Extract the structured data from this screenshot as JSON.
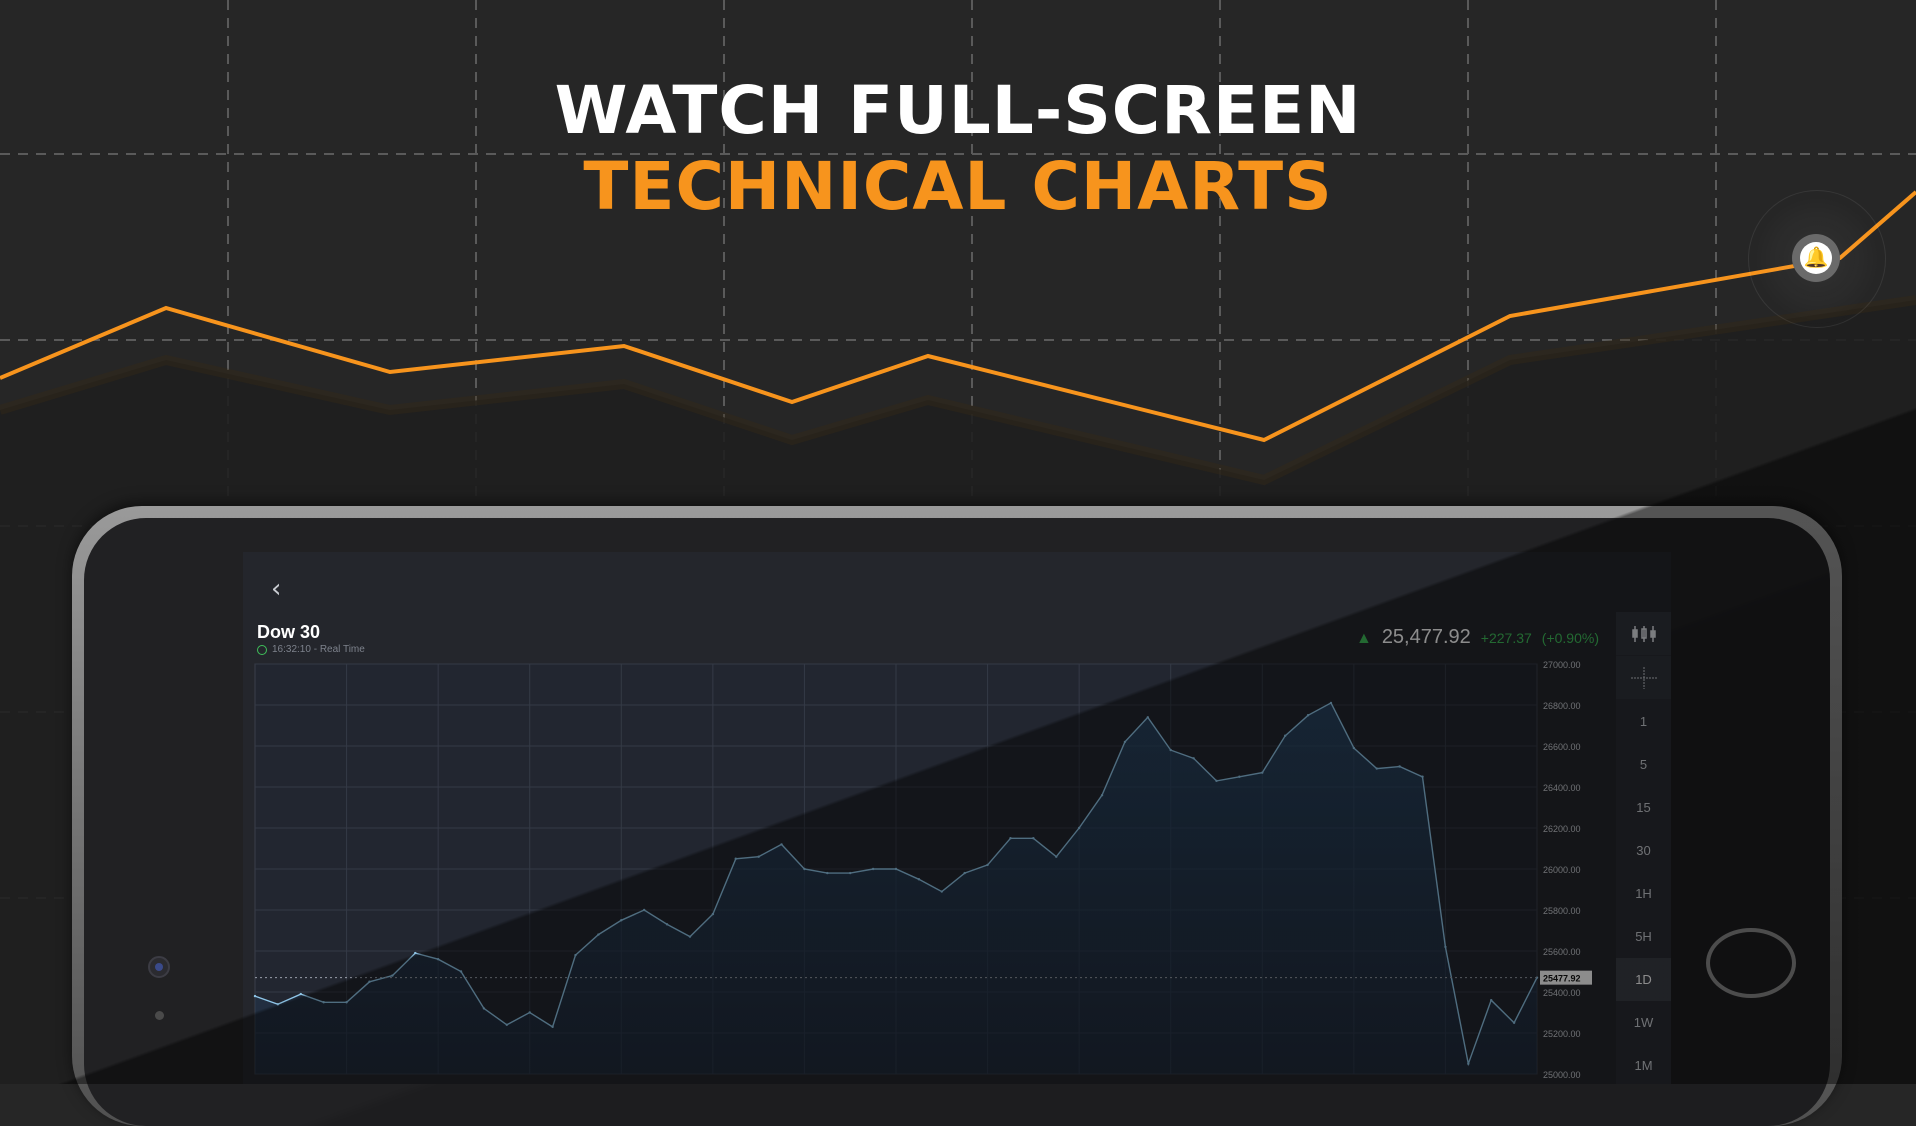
{
  "headline": {
    "line1": "WATCH FULL-SCREEN",
    "line2": "TECHNICAL CHARTS",
    "accent_color": "#f7941d"
  },
  "alert_icon": "bell-icon",
  "screen": {
    "back_icon": "chevron-left-icon",
    "symbol": "Dow 30",
    "time_text": "16:32:10 - Real Time",
    "price": "25,477.92",
    "change": "+227.37",
    "change_pct": "(+0.90%)",
    "up_color": "#3fbf5a",
    "last_price_tag": "25477.92",
    "toolbar": {
      "chart_type_icon": "candlestick-icon",
      "crosshair_icon": "crosshair-icon",
      "intervals": [
        "1",
        "5",
        "15",
        "30",
        "1H",
        "5H",
        "1D",
        "1W",
        "1M"
      ],
      "selected": "1D"
    }
  },
  "chart_data": {
    "type": "area",
    "title": "",
    "xlabel": "",
    "ylabel": "",
    "ylim": [
      25000,
      27000
    ],
    "y_ticks": [
      "27000.00",
      "26800.00",
      "26600.00",
      "26400.00",
      "26200.00",
      "26000.00",
      "25800.00",
      "25600.00",
      "25400.00",
      "25200.00",
      "25000.00"
    ],
    "series": [
      {
        "values": [
          25380,
          25340,
          25390,
          25350,
          25350,
          25450,
          25480,
          25590,
          25560,
          25500,
          25320,
          25240,
          25300,
          25230,
          25580,
          25680,
          25750,
          25800,
          25730,
          25670,
          25780,
          26050,
          26060,
          26120,
          26000,
          25980,
          25980,
          26000,
          26000,
          25950,
          25890,
          25980,
          26020,
          26150,
          26150,
          26060,
          26200,
          26360,
          26620,
          26740,
          26580,
          26540,
          26430,
          26450,
          26470,
          26650,
          26750,
          26810,
          26590,
          26490,
          26500,
          26450,
          25620,
          25050,
          25360,
          25250,
          25470
        ]
      }
    ],
    "grid": true
  }
}
